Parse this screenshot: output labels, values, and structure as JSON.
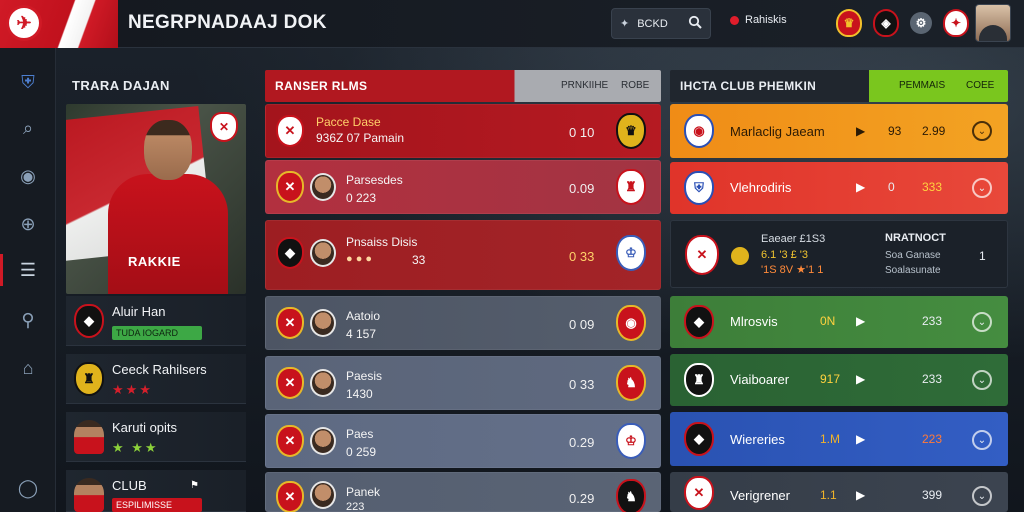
{
  "app": {
    "title": "NEGRPNADAAJ DOK"
  },
  "search": {
    "icon_label": "BCKD"
  },
  "live": {
    "label": "Rahiskis"
  },
  "left_panel": {
    "title": "TRARA DAJAN",
    "hero_name": "RAKKIE",
    "cards": [
      {
        "name": "Aluir Han",
        "tag": "TUDA IOGARD",
        "stars": ""
      },
      {
        "name": "Ceeck Rahilsers",
        "tag": "",
        "stars": "★★★"
      },
      {
        "name": "Karuti opits",
        "tag": "",
        "stars": "★ ★★"
      },
      {
        "name": "CLUB",
        "tag": "ESPILIMISSE",
        "stars": ""
      }
    ]
  },
  "middle_panel": {
    "title": "RANSER RLMS",
    "col1": "PRNKIIHE",
    "col2": "ROBE",
    "rows": [
      {
        "name": "Pacce Dase",
        "sub": "936Z 07 Pamain",
        "value": "0 10"
      },
      {
        "name": "Parsesdes",
        "sub": "0 223",
        "value": "0.09"
      },
      {
        "name": "Pnsaiss   Disis",
        "sub": "33",
        "value": "0 33"
      },
      {
        "name": "Aatoio",
        "sub": "4 157",
        "value": "0 09"
      },
      {
        "name": "Paesis",
        "sub": "1430",
        "value": "0 33"
      },
      {
        "name": "Paes",
        "sub": "0 259",
        "value": "0.29"
      },
      {
        "name": "Panek",
        "sub": "223",
        "value": "0.29"
      }
    ]
  },
  "right_panel": {
    "title": "IHCTA CLUB PHEMKIN",
    "col1": "PEMMAIS",
    "col2": "COEE",
    "rows": [
      {
        "name": "Marlaclig Jaeam",
        "arrow": "▶",
        "v1": "93",
        "v2": "2.99",
        "color": "#f29a1b"
      },
      {
        "name": "Vlehrodiris",
        "arrow": "▶",
        "v1": "0",
        "v2": "333",
        "color": "#e33a2a"
      },
      {
        "name": "Mlrosvis",
        "arrow": "▶",
        "v1": "0N",
        "v2": "233",
        "color": "#3f8a3a"
      },
      {
        "name": "Viaiboarer",
        "arrow": "▶",
        "v1": "917",
        "v2": "233",
        "color": "#2d6b36"
      },
      {
        "name": "Wiereries",
        "arrow": "▶",
        "v1": "1.M",
        "v2": "223",
        "color": "#2f56b8"
      },
      {
        "name": "Verigrener",
        "arrow": "▶",
        "v1": "1.1",
        "v2": "399",
        "color": "#3a424c"
      }
    ],
    "detail": {
      "line1": "Eaeaer   £1S3",
      "line2": "6.1 '3 £ '3",
      "line3": "'1S 8V  ★'1 1",
      "head": "NRATNOCT",
      "sub1": "Soa Ganase",
      "sub2": "Soalasunate",
      "count": "1"
    }
  },
  "colors": {
    "accent": "#d01a26",
    "green": "#7ac61e"
  }
}
